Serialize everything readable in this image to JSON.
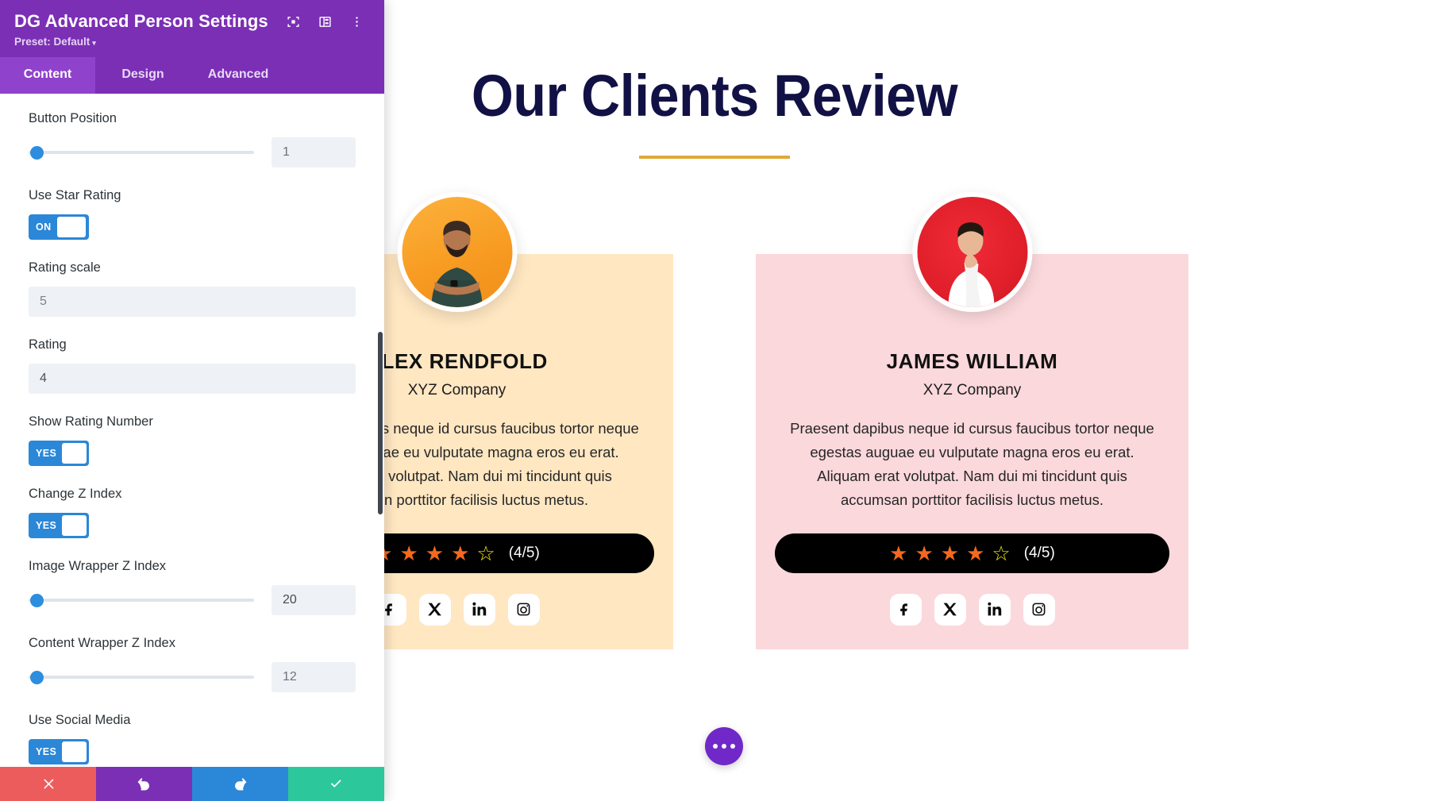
{
  "panel": {
    "title": "DG Advanced Person Settings",
    "preset_label": "Preset: Default",
    "preset_caret": "▾",
    "icons": {
      "focus": "focus-target-icon",
      "layout": "layout-columns-icon",
      "more": "more-vertical-icon"
    },
    "tabs": [
      {
        "label": "Content",
        "active": true
      },
      {
        "label": "Design",
        "active": false
      },
      {
        "label": "Advanced",
        "active": false
      }
    ],
    "fields": [
      {
        "label": "Button Position",
        "type": "slider",
        "value": "1",
        "filled": false
      },
      {
        "label": "Use Star Rating",
        "type": "toggle",
        "value": "ON"
      },
      {
        "label": "Rating scale",
        "type": "text",
        "value": "5",
        "filled": false
      },
      {
        "label": "Rating",
        "type": "text",
        "value": "4",
        "filled": true
      },
      {
        "label": "Show Rating Number",
        "type": "toggle",
        "value": "YES"
      },
      {
        "label": "Change Z Index",
        "type": "toggle",
        "value": "YES"
      },
      {
        "label": "Image Wrapper Z Index",
        "type": "slider",
        "value": "20",
        "filled": true
      },
      {
        "label": "Content Wrapper Z Index",
        "type": "slider",
        "value": "12",
        "filled": false
      },
      {
        "label": "Use Social Media",
        "type": "toggle",
        "value": "YES"
      }
    ],
    "footer": [
      {
        "name": "cancel-button",
        "glyph": "✖",
        "class": "pf-close"
      },
      {
        "name": "undo-button",
        "glyph": "↺",
        "class": "pf-undo"
      },
      {
        "name": "redo-button",
        "glyph": "↻",
        "class": "pf-redo"
      },
      {
        "name": "save-button",
        "glyph": "✔",
        "class": "pf-save"
      }
    ]
  },
  "page": {
    "heading": "Our Clients Review",
    "accent_underline_color": "#e0a93a",
    "heading_color": "#111145",
    "fab_label": "options-dots"
  },
  "cards": [
    {
      "name": "ALEX RENDFOLD",
      "company": "XYZ Company",
      "description": "Praesent dapibus neque id cursus faucibus tortor neque egestas auguae eu vulputate magna eros eu erat. Aliquam erat volutpat. Nam dui mi tincidunt quis accumsan porttitor facilisis luctus metus.",
      "rating_text": "(4/5)",
      "stars_full": 4,
      "stars_empty": 1,
      "bg": "#ffe7c2",
      "avatar_bg": "#f79a21",
      "socials": [
        "facebook",
        "x-twitter",
        "linkedin",
        "instagram"
      ]
    },
    {
      "name": "JAMES WILLIAM",
      "company": "XYZ Company",
      "description": "Praesent dapibus neque id cursus faucibus tortor neque egestas auguae eu vulputate magna eros eu erat. Aliquam erat volutpat. Nam dui mi tincidunt quis accumsan porttitor facilisis luctus metus.",
      "rating_text": "(4/5)",
      "stars_full": 4,
      "stars_empty": 1,
      "bg": "#fbd8dc",
      "avatar_bg": "#e01f2b",
      "socials": [
        "facebook",
        "x-twitter",
        "linkedin",
        "instagram"
      ]
    }
  ]
}
